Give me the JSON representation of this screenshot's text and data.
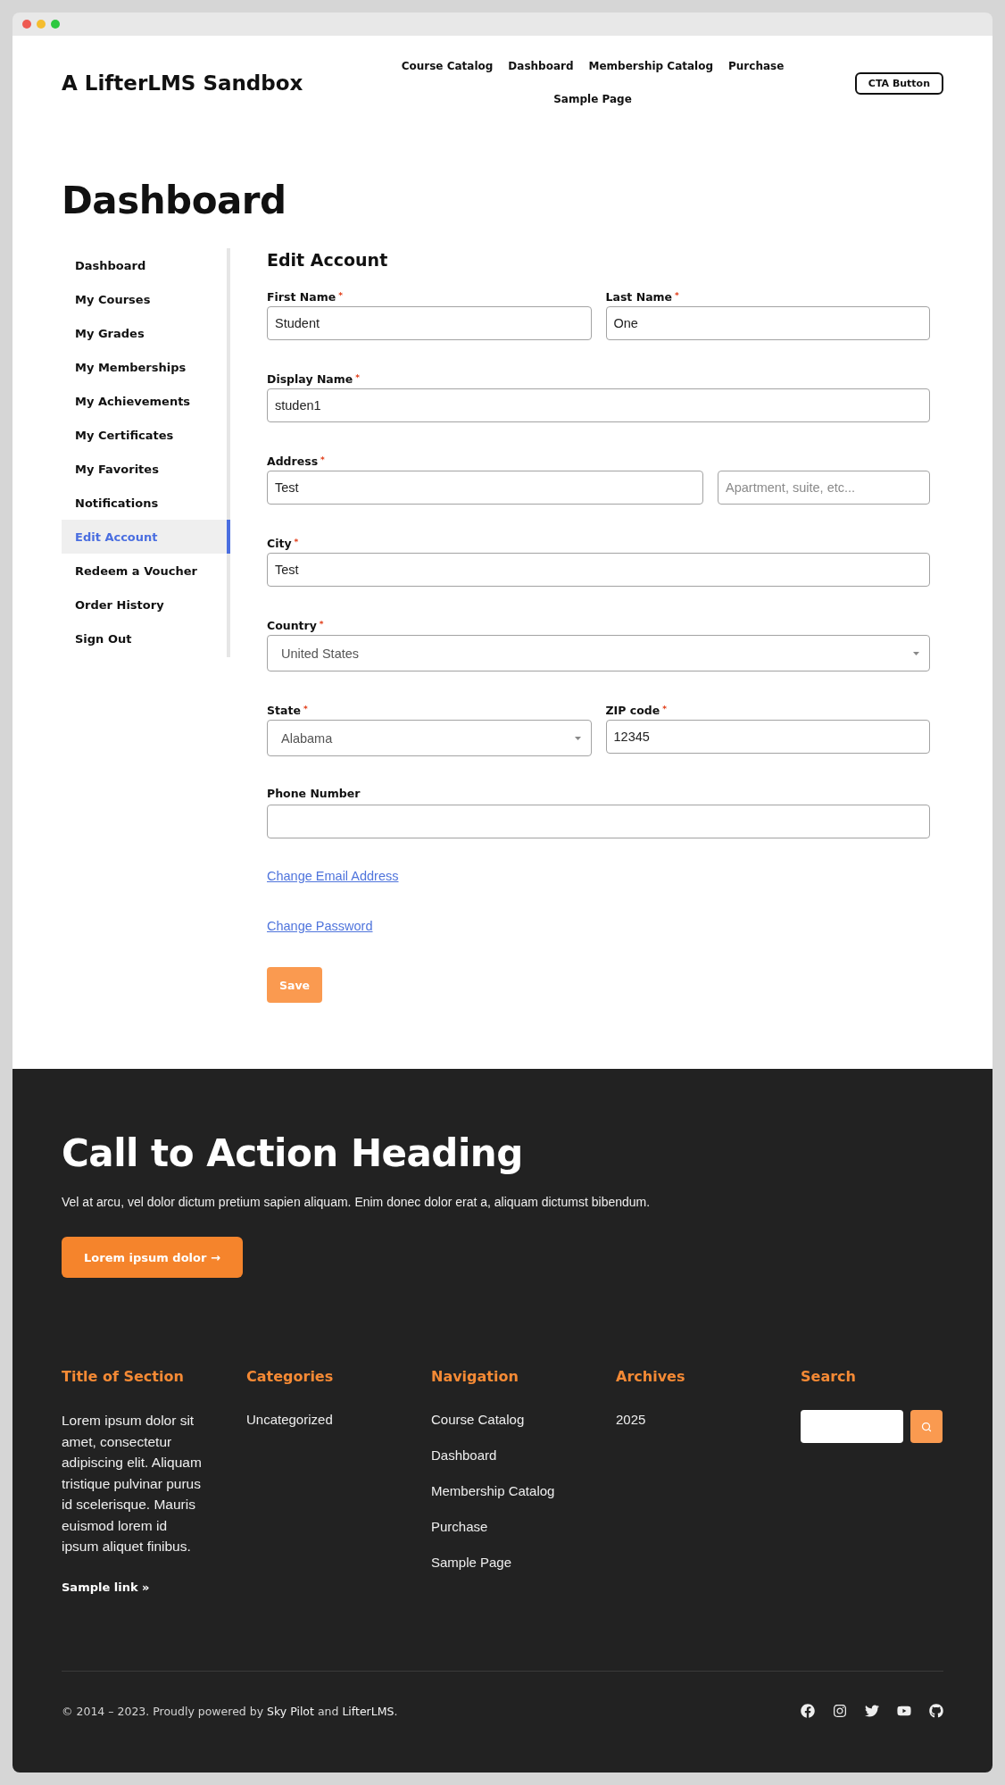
{
  "header": {
    "site_title": "A LifterLMS Sandbox",
    "nav": [
      "Course Catalog",
      "Dashboard",
      "Membership Catalog",
      "Purchase",
      "Sample Page"
    ],
    "cta_button": "CTA Button"
  },
  "page_title": "Dashboard",
  "sidebar": {
    "items": [
      {
        "label": "Dashboard",
        "selected": false
      },
      {
        "label": "My Courses",
        "selected": false
      },
      {
        "label": "My Grades",
        "selected": false
      },
      {
        "label": "My Memberships",
        "selected": false
      },
      {
        "label": "My Achievements",
        "selected": false
      },
      {
        "label": "My Certificates",
        "selected": false
      },
      {
        "label": "My Favorites",
        "selected": false
      },
      {
        "label": "Notifications",
        "selected": false
      },
      {
        "label": "Edit Account",
        "selected": true
      },
      {
        "label": "Redeem a Voucher",
        "selected": false
      },
      {
        "label": "Order History",
        "selected": false
      },
      {
        "label": "Sign Out",
        "selected": false
      }
    ]
  },
  "form": {
    "title": "Edit Account",
    "rows": [
      [
        {
          "kind": "text",
          "label": "First Name",
          "mark": "*",
          "value": "Student"
        },
        {
          "kind": "text",
          "label": "Last Name",
          "mark": "*",
          "value": "One"
        }
      ],
      [
        {
          "kind": "text",
          "label": "Display Name",
          "mark": "*",
          "value": "studen1"
        }
      ],
      [
        {
          "kind": "text",
          "label": "Address",
          "mark": "*",
          "value": "Test"
        },
        {
          "kind": "text",
          "placeholder": "Apartment, suite, etc..."
        }
      ],
      [
        {
          "kind": "text",
          "label": "City",
          "mark": "*",
          "value": "Test"
        }
      ],
      [
        {
          "kind": "select",
          "label": "Country",
          "mark": "*",
          "value": "United States"
        }
      ],
      [
        {
          "kind": "select",
          "label": "State",
          "mark": "*",
          "value": "Alabama"
        },
        {
          "kind": "text",
          "label": "ZIP code",
          "mark": "*",
          "value": "12345"
        }
      ],
      [
        {
          "kind": "text",
          "label": "Phone Number"
        }
      ]
    ],
    "links": [
      "Change Email Address",
      "Change Password"
    ],
    "save_button": "Save"
  },
  "cta": {
    "heading": "Call to Action Heading",
    "text": "Vel at arcu, vel dolor dictum pretium sapien aliquam. Enim donec dolor erat a, aliquam dictumst bibendum.",
    "button": "Lorem ipsum dolor →"
  },
  "footer": {
    "columns": [
      {
        "kind": "text",
        "title": "Title of Section",
        "text": "Lorem ipsum dolor sit amet, consectetur adipiscing elit. Aliquam tristique pulvinar purus id scelerisque. Mauris euismod lorem id ipsum aliquet finibus.",
        "link": "Sample link »"
      },
      {
        "kind": "links",
        "title": "Categories",
        "links": [
          "Uncategorized"
        ]
      },
      {
        "kind": "links",
        "title": "Navigation",
        "links": [
          "Course Catalog",
          "Dashboard",
          "Membership Catalog",
          "Purchase",
          "Sample Page"
        ]
      },
      {
        "kind": "links",
        "title": "Archives",
        "links": [
          "2025"
        ]
      },
      {
        "kind": "search",
        "title": "Search"
      }
    ],
    "copyright": [
      {
        "kind": "text",
        "text": "© 2014 – 2023. Proudly powered by "
      },
      {
        "kind": "link",
        "text": "Sky Pilot"
      },
      {
        "kind": "text",
        "text": " and "
      },
      {
        "kind": "link",
        "text": "LifterLMS"
      },
      {
        "kind": "text",
        "text": "."
      }
    ]
  }
}
